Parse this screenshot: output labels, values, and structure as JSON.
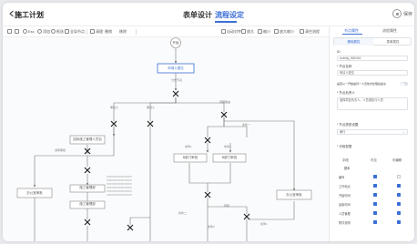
{
  "header": {
    "app_title": "施工计划",
    "tabs": [
      "表单设计",
      "流程设定"
    ],
    "save_label": "保存"
  },
  "toolbar": {
    "items": [
      "Esc",
      "添加",
      "框选",
      "全局节点",
      "…",
      "清理",
      "撤销",
      "移除",
      "保存",
      "放大",
      "缩小",
      "自动对齐",
      "放大缩小",
      "清空流程"
    ]
  },
  "canvas": {
    "start_label": "开始",
    "nodes": {
      "apply": "申请人提交",
      "n_left1": "招标施工管理人员包",
      "n_left2": "施工管理部",
      "n_left3": "施工管理部",
      "n_mid1": "B部门审批",
      "n_mid2": "B部门审批",
      "n_right": "办公室审批",
      "n_far_left": "办公室审批"
    },
    "edge_labels": {
      "e1": "分支节点",
      "e2": "审批人",
      "e3": "流程路由",
      "e4": "条件一",
      "e5": "条件二",
      "e6": "同意",
      "e7": "条件1",
      "e8": "条件2",
      "e9": "领导审批"
    },
    "notes": "XXXXXXXXXXXXXXXXXXXXXXXXXXXXXXXXXXXXXXXX"
  },
  "panel": {
    "tabs": [
      "节点属性",
      "流程属性"
    ],
    "subtabs": [
      "基础属性",
      "表单属性"
    ],
    "fields": [
      {
        "label": "ID",
        "value": "Activity_0t2b3c9"
      },
      {
        "label": "* 节点名称",
        "value": "申请人提交"
      },
      {
        "label": "是否从一开始由同一人员依次处理后提交",
        "value": ""
      },
      {
        "label": "* 节点负责人",
        "value": "选择项目负责人、人员或执行人员"
      },
      {
        "label": "* 节点类型设置",
        "value": "串行"
      }
    ],
    "field_table": {
      "title": "* 字段权限",
      "headers": [
        "字段",
        "可见",
        "可编辑"
      ],
      "rows": [
        {
          "name": "基本",
          "view": null,
          "edit": null
        },
        {
          "name": "编号",
          "view": true,
          "edit": false
        },
        {
          "name": "工作地点",
          "view": true,
          "edit": true
        },
        {
          "name": "开始时间",
          "view": true,
          "edit": true
        },
        {
          "name": "结束时间",
          "view": true,
          "edit": true
        },
        {
          "name": "人员管理",
          "view": true,
          "edit": true
        },
        {
          "name": "附件说明",
          "view": true,
          "edit": true
        }
      ]
    }
  }
}
